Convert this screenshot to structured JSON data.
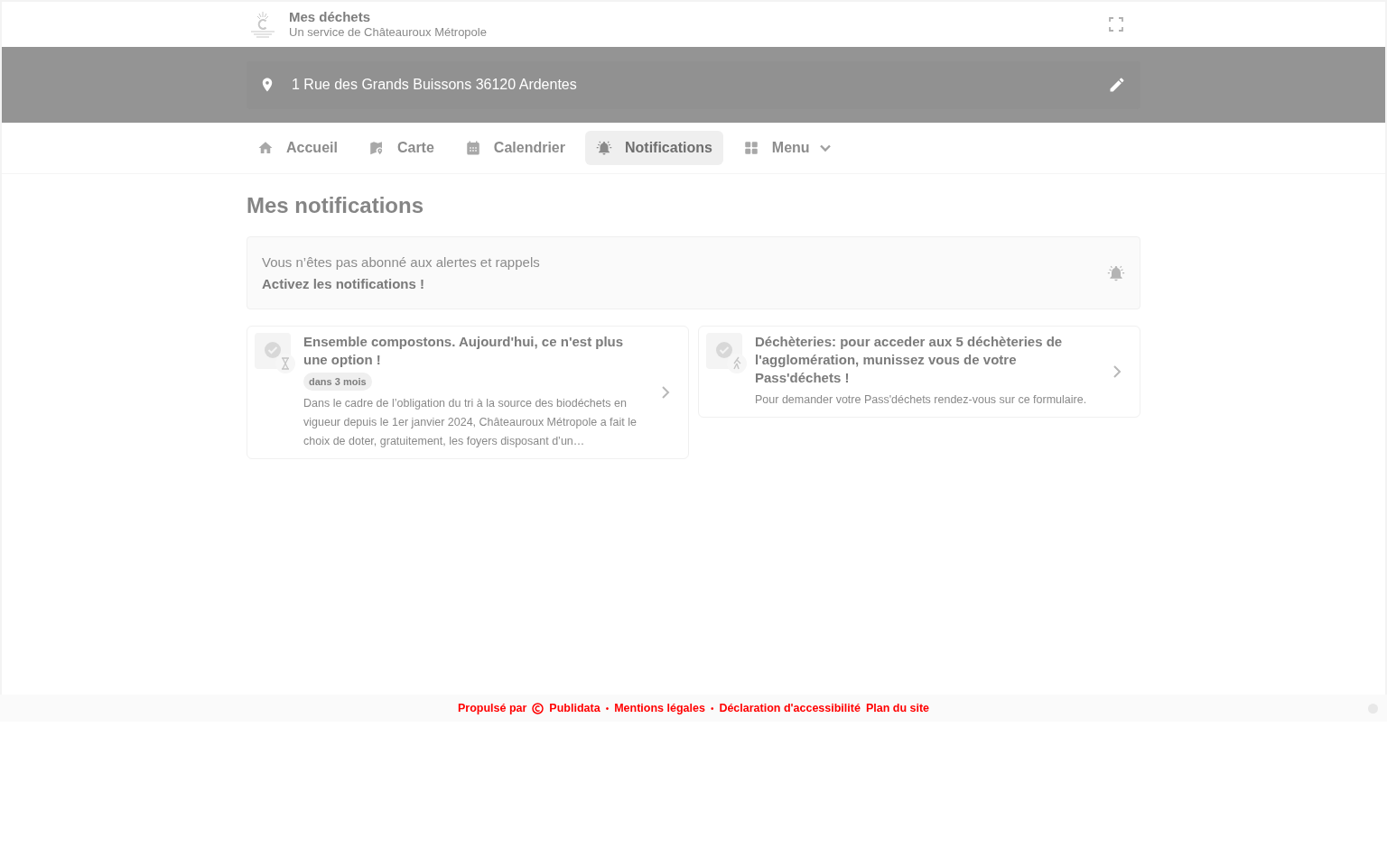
{
  "header": {
    "title": "Mes déchets",
    "subtitle": "Un service de Châteauroux Métropole"
  },
  "address": {
    "value": "1 Rue des Grands Buissons 36120 Ardentes"
  },
  "nav": [
    {
      "label": "Accueil",
      "kind": "link",
      "selected": false
    },
    {
      "label": "Carte",
      "kind": "link",
      "selected": false
    },
    {
      "label": "Calendrier",
      "kind": "link",
      "selected": false
    },
    {
      "label": "Notifications",
      "kind": "link",
      "selected": true
    },
    {
      "label": "Menu",
      "kind": "dropdown",
      "selected": false
    }
  ],
  "page_title": "Mes notifications",
  "alert": {
    "message": "Vous n’êtes pas abonné aux alertes et rappels",
    "action": "Activez les notifications !"
  },
  "notifications": [
    {
      "title": "Ensemble compostons. Aujourd'hui, ce n'est plus une option !",
      "tag": "dans 3 mois",
      "description": "Dans le cadre de l’obligation du tri à la source des biodéchets en vigueur depuis le 1er janvier 2024, Châteauroux Métropole a fait le choix de doter, gratuitement, les foyers disposant d’un…"
    },
    {
      "title": "Déchèteries: pour acceder aux 5 déchèteries de l'agglomération, munissez vous de votre Pass'déchets !",
      "description": "Pour demander votre Pass'déchets rendez-vous sur ce formulaire."
    }
  ],
  "footer": {
    "items": [
      {
        "kind": "text",
        "text": "Propulsé par"
      },
      {
        "kind": "logo"
      },
      {
        "kind": "link",
        "text": "Publidata"
      },
      {
        "kind": "separator",
        "text": "•"
      },
      {
        "kind": "link",
        "text": "Mentions légales"
      },
      {
        "kind": "separator",
        "text": "•"
      },
      {
        "kind": "link",
        "text": "Déclaration d'accessibilité"
      },
      {
        "kind": "link",
        "text": "Plan du site"
      }
    ]
  }
}
